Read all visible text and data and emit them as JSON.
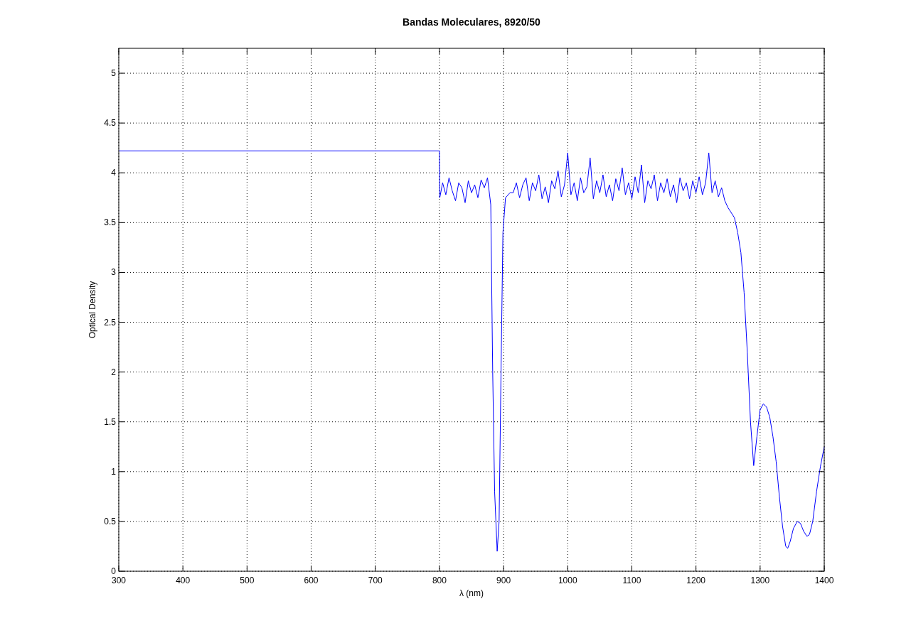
{
  "figure": {
    "chart_data": {
      "type": "line",
      "title": "Bandas Moleculares, 8920/50",
      "xlabel": "λ (nm)",
      "ylabel": "Optical Density",
      "grid": true,
      "xlim": [
        300,
        1400
      ],
      "ylim": [
        0,
        5.25
      ],
      "xticks": [
        300,
        400,
        500,
        600,
        700,
        800,
        900,
        1000,
        1100,
        1200,
        1300,
        1400
      ],
      "yticks": [
        0,
        0.5,
        1,
        1.5,
        2,
        2.5,
        3,
        3.5,
        4,
        4.5,
        5
      ],
      "x": [
        300,
        800,
        800.5,
        805,
        810,
        815,
        820,
        825,
        830,
        835,
        840,
        845,
        850,
        855,
        860,
        865,
        870,
        875,
        880,
        883,
        886,
        890,
        893,
        896,
        899,
        903,
        910,
        915,
        920,
        925,
        930,
        935,
        940,
        945,
        950,
        955,
        960,
        965,
        970,
        975,
        980,
        985,
        990,
        995,
        1000,
        1005,
        1010,
        1015,
        1020,
        1025,
        1030,
        1035,
        1040,
        1045,
        1050,
        1055,
        1060,
        1065,
        1070,
        1075,
        1080,
        1085,
        1090,
        1095,
        1100,
        1105,
        1110,
        1115,
        1120,
        1125,
        1130,
        1135,
        1140,
        1145,
        1150,
        1155,
        1160,
        1165,
        1170,
        1175,
        1180,
        1185,
        1190,
        1195,
        1200,
        1205,
        1210,
        1215,
        1220,
        1225,
        1230,
        1235,
        1240,
        1245,
        1250,
        1260,
        1265,
        1270,
        1275,
        1280,
        1285,
        1290,
        1295,
        1300,
        1305,
        1310,
        1315,
        1320,
        1325,
        1330,
        1335,
        1340,
        1343,
        1347,
        1352,
        1358,
        1363,
        1368,
        1373,
        1377,
        1382,
        1388,
        1394,
        1400
      ],
      "series": [
        {
          "color": "#0000ff",
          "values": [
            4.22,
            4.22,
            3.75,
            3.9,
            3.78,
            3.95,
            3.82,
            3.72,
            3.9,
            3.85,
            3.7,
            3.92,
            3.8,
            3.88,
            3.75,
            3.93,
            3.85,
            3.95,
            3.68,
            2.0,
            0.8,
            0.2,
            0.5,
            2.0,
            3.4,
            3.75,
            3.8,
            3.8,
            3.9,
            3.75,
            3.88,
            3.95,
            3.72,
            3.9,
            3.82,
            3.98,
            3.74,
            3.86,
            3.7,
            3.92,
            3.84,
            4.02,
            3.76,
            3.88,
            4.2,
            3.78,
            3.9,
            3.72,
            3.95,
            3.8,
            3.86,
            4.15,
            3.74,
            3.92,
            3.8,
            3.98,
            3.76,
            3.88,
            3.72,
            3.94,
            3.82,
            4.05,
            3.78,
            3.9,
            3.74,
            3.96,
            3.8,
            4.08,
            3.7,
            3.92,
            3.84,
            3.98,
            3.72,
            3.9,
            3.8,
            3.94,
            3.76,
            3.88,
            3.7,
            3.95,
            3.82,
            3.9,
            3.74,
            3.92,
            3.8,
            3.96,
            3.78,
            3.9,
            4.2,
            3.8,
            3.92,
            3.76,
            3.85,
            3.72,
            3.65,
            3.55,
            3.4,
            3.2,
            2.8,
            2.2,
            1.5,
            1.06,
            1.35,
            1.62,
            1.68,
            1.65,
            1.55,
            1.35,
            1.1,
            0.75,
            0.45,
            0.25,
            0.23,
            0.3,
            0.43,
            0.5,
            0.48,
            0.4,
            0.35,
            0.37,
            0.5,
            0.8,
            1.05,
            1.25
          ]
        }
      ]
    }
  }
}
